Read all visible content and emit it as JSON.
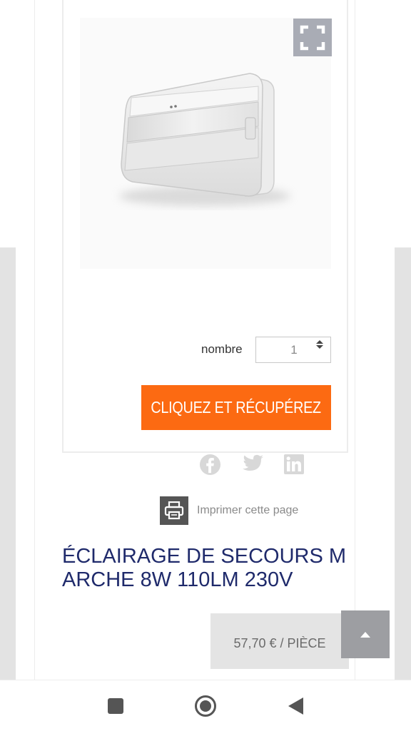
{
  "product": {
    "title": "ÉCLAIRAGE DE SECOURS MARCHE 8W 110LM 230V",
    "price": "57,70 € / PIÈCE",
    "image_alt": "emergency-light-fixture"
  },
  "quantity": {
    "label": "nombre",
    "value": "1"
  },
  "cta": {
    "label": "CLIQUEZ ET RÉCUPÉREZ",
    "color": "#fc6a12"
  },
  "social": {
    "items": [
      "facebook-icon",
      "twitter-icon",
      "linkedin-icon"
    ]
  },
  "print": {
    "label": "Imprimer cette page"
  },
  "colors": {
    "title": "#1f2a6b",
    "fullscreen_button": "#a9acb5",
    "scroll_top_button": "#9d9ea2",
    "price_bg": "#e4e4e4"
  },
  "icons": {
    "fullscreen": "fullscreen-icon",
    "print": "printer-icon",
    "scroll_top": "arrow-up-icon",
    "quantity_spinner": "spinner-arrows-icon",
    "nav_recent": "square-icon",
    "nav_home": "circle-icon",
    "nav_back": "triangle-back-icon"
  }
}
